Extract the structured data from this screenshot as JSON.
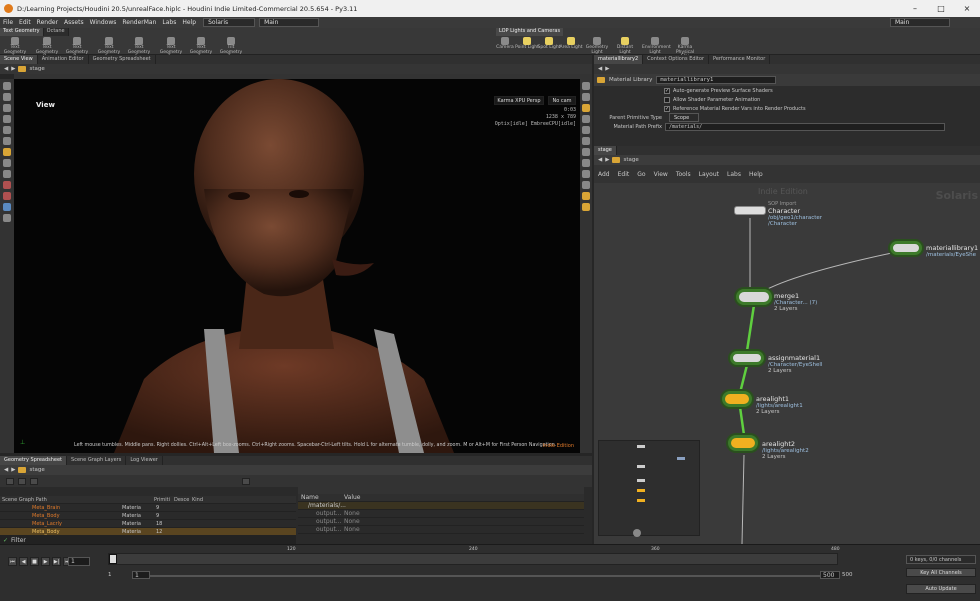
{
  "window": {
    "title": "D:/Learning Projects/Houdini 20.5/unrealFace.hiplc - Houdini Indie Limited-Commercial 20.5.654 - Py3.11"
  },
  "menubar": {
    "items": [
      "File",
      "Edit",
      "Render",
      "Assets",
      "Windows",
      "RenderMan",
      "Labs",
      "Help"
    ],
    "desktop": "Solaris",
    "context": "Main",
    "right_context": "Main"
  },
  "shelf": {
    "tabs": [
      "Text Geometry",
      "Octane"
    ],
    "tools": [
      "Text Geometry T...",
      "Text Geometry B...",
      "Text Geometry R...",
      "Text Geometry S...",
      "Text Geometry S...",
      "Text Geometry T...",
      "Text Geometry T...",
      "Tilt Geometry T..."
    ],
    "light_tabs": [
      "LOP Lights and Cameras"
    ],
    "light_tools": [
      "Camera",
      "Point Light",
      "Spot Light",
      "Area Light",
      "Geometry Light",
      "Distant Light",
      "Environment Light",
      "Karma Physical Sky"
    ]
  },
  "scene_view": {
    "tabs": [
      "Scene View",
      "Animation Editor",
      "Geometry Spreadsheet"
    ],
    "path": "stage",
    "label": "View",
    "renderer": "Karma XPU Persp",
    "camera": "No cam",
    "stats": [
      "0:03",
      "1238 x 789",
      "Optix[idle] EmbreeCPU[idle]"
    ],
    "hint": "Left mouse tumbles. Middle pans. Right dollies. Ctrl+Alt+Left box-zooms. Ctrl+Right zooms. Spacebar-Ctrl-Left tilts. Hold L for alternate tumble, dolly, and zoom. M or Alt+M for First Person Navigation.",
    "watermark": "Indie Edition"
  },
  "scene_graph": {
    "tabs": [
      "Geometry Spreadsheet",
      "Scene Graph Layers",
      "Log Viewer"
    ],
    "path": "stage",
    "columns": [
      "Scene Graph Path",
      "Primiti",
      "Desce",
      "Kind"
    ],
    "rows": [
      {
        "name": "Meta_Brain",
        "prim": "Materia",
        "desc": "9"
      },
      {
        "name": "Meta_Body",
        "prim": "Materia",
        "desc": "9"
      },
      {
        "name": "Meta_Lacrly",
        "prim": "Materia",
        "desc": "18"
      },
      {
        "name": "Meta_Body",
        "prim": "Materia",
        "desc": "12"
      }
    ],
    "filter": "Filter",
    "detail_columns": [
      "Name",
      "Value"
    ],
    "detail_rows": [
      {
        "name": "/materials/...",
        "value": ""
      },
      {
        "name": "output...",
        "value": "None"
      },
      {
        "name": "output...",
        "value": "None"
      },
      {
        "name": "output...",
        "value": "None"
      }
    ]
  },
  "params": {
    "tabs": [
      "materiallibrary2",
      "Context Options Editor",
      "Performance Monitor"
    ],
    "node_type": "Material Library",
    "node_name": "materiallibrary1",
    "options": [
      {
        "label": "Auto-generate Preview Surface Shaders",
        "checked": true
      },
      {
        "label": "Allow Shader Parameter Animation",
        "checked": false
      },
      {
        "label": "Reference Material Render Vars into Render Products",
        "checked": true
      }
    ],
    "parent_prim_label": "Parent Primitive Type",
    "parent_prim_value": "Scope",
    "mat_path_label": "Material Path Prefix",
    "mat_path_value": "/materials/"
  },
  "network": {
    "tabs": [
      "stage"
    ],
    "path": "stage",
    "menu": [
      "Add",
      "Edit",
      "Go",
      "View",
      "Tools",
      "Layout",
      "Labs",
      "Help"
    ],
    "watermark": "Indie Edition",
    "context_label": "Solaris",
    "nodes": [
      {
        "name": "Character",
        "type": "SOP Import",
        "sub1": "/obj/geo1/character",
        "sub2": "/Character"
      },
      {
        "name": "materiallibrary1",
        "sub1": "/materials/EyeShe"
      },
      {
        "name": "merge1",
        "sub1": "/Character... (7)",
        "sub2": "2 Layers"
      },
      {
        "name": "assignmaterial1",
        "sub1": "/Character/EyeShell",
        "sub2": "2 Layers"
      },
      {
        "name": "arealight1",
        "sub1": "/lights/arealight1",
        "sub2": "2 Layers"
      },
      {
        "name": "arealight2",
        "sub1": "/lights/arealight2",
        "sub2": "2 Layers"
      }
    ]
  },
  "timeline": {
    "frame": "1",
    "start": "1",
    "start2": "1",
    "end": "500",
    "end2": "500",
    "ticks": [
      "120",
      "240",
      "360",
      "480"
    ],
    "keys": "0 keys, 0/0 channels",
    "key_all": "Key All Channels",
    "auto_update": "Auto Update"
  },
  "colors": {
    "accent": "#e07a1a",
    "node_green": "#3d7a2a",
    "light_yellow": "#f0b020"
  }
}
